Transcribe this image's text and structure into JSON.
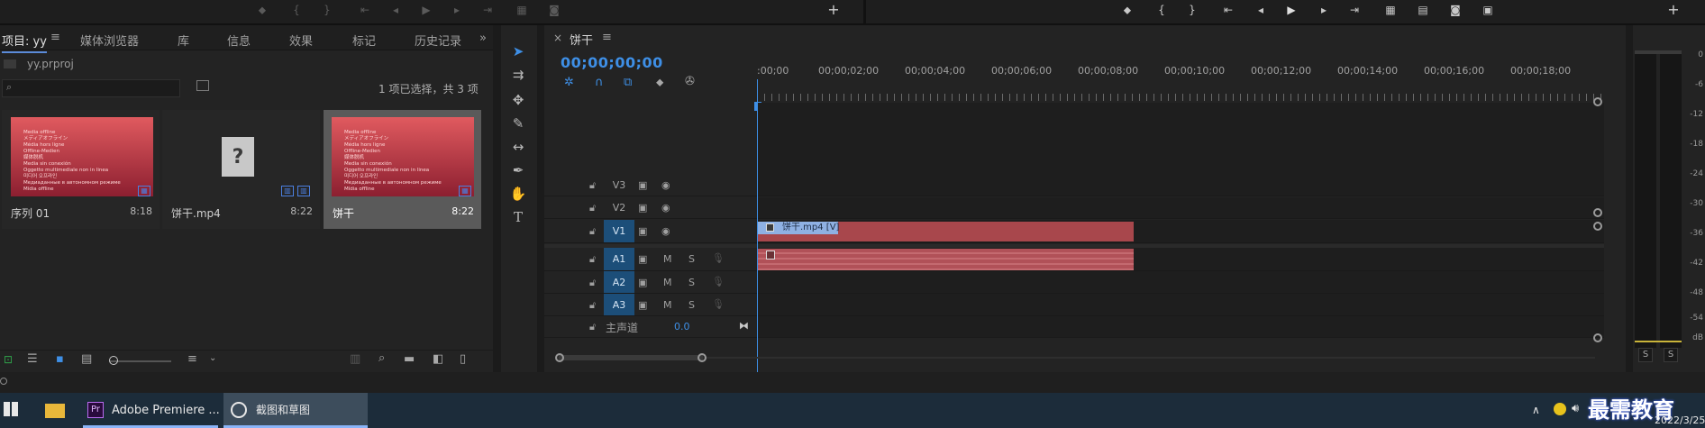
{
  "project": {
    "tabs": [
      "项目: yy",
      "媒体浏览器",
      "库",
      "信息",
      "效果",
      "标记",
      "历史记录"
    ],
    "path": "yy.prproj",
    "selection_status": "1 项已选择，共 3 项",
    "clips": [
      {
        "name": "序列 01",
        "duration": "8:18"
      },
      {
        "name": "饼干.mp4",
        "duration": "8:22"
      },
      {
        "name": "饼干",
        "duration": "8:22"
      }
    ],
    "offline_text": "Media offline\nメディアオフライン\nMédia hors ligne\nOffline-Medien\n媒体脱机\nMedia sin conexión\nOggetto multimediale non in linea\n미디어 오프라인\nМедиаданные в автономном режиме\nMídia offline"
  },
  "timeline": {
    "sequence_name": "饼干",
    "timecode": "00;00;00;00",
    "ruler_labels": [
      ":00;00",
      "00;00;02;00",
      "00;00;04;00",
      "00;00;06;00",
      "00;00;08;00",
      "00;00;10;00",
      "00;00;12;00",
      "00;00;14;00",
      "00;00;16;00",
      "00;00;18;00"
    ],
    "video_tracks": [
      "V3",
      "V2",
      "V1"
    ],
    "audio_tracks": [
      "A1",
      "A2",
      "A3"
    ],
    "mute_label": "M",
    "solo_label": "S",
    "master_label": "主声道",
    "master_value": "0.0",
    "video_clip_label": "饼干.mp4 [V]"
  },
  "meter": {
    "db_labels": [
      "0",
      "-6",
      "-12",
      "-18",
      "-24",
      "-30",
      "-36",
      "-42",
      "-48",
      "-54",
      "dB"
    ],
    "solo_buttons": [
      "S",
      "S"
    ]
  },
  "taskbar": {
    "premiere_label": "Adobe Premiere ...",
    "snip_label": "截图和草图",
    "date": "2022/3/25",
    "watermark": "最需教育"
  },
  "colors": {
    "accent": "#3e8fe6",
    "clip": "#a8474c",
    "selected_track": "#1c4e79"
  }
}
